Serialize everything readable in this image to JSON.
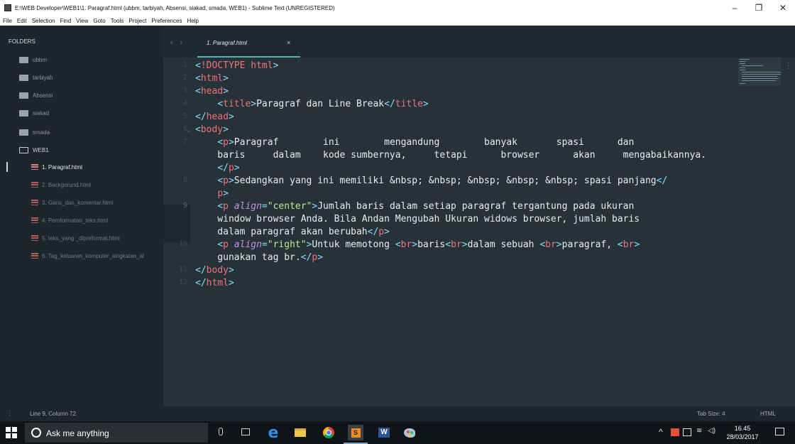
{
  "window": {
    "title": "E:\\WEB Developer\\WEB1\\1. Paragraf.html (ubbm, tarbiyah, Absensi, siakad, smada, WEB1) - Sublime Text (UNREGISTERED)",
    "minimize": "–",
    "maximize": "❐",
    "close": "✕"
  },
  "menu": [
    "File",
    "Edit",
    "Selection",
    "Find",
    "View",
    "Goto",
    "Tools",
    "Project",
    "Preferences",
    "Help"
  ],
  "sidebar": {
    "header": "FOLDERS",
    "folders": [
      "ubbm",
      "tarbiyah",
      "Absensi",
      "siakad",
      "smada",
      "WEB1"
    ],
    "files": [
      "1. Paragraf.html",
      "2. Backgorund.html",
      "3. Garis_dan_komentar.html",
      "4. Pemformatan_teks.html",
      "5. teks_yang _dipreformat.html",
      "6. Tag_keluaran_komputer_singkatan_al"
    ],
    "active_file_index": 0
  },
  "tabs": [
    {
      "label": "1. Paragraf.html",
      "close": "×",
      "active": true
    }
  ],
  "editor": {
    "line_numbers": [
      "1",
      "2",
      "3",
      "4",
      "5",
      "6",
      "7",
      "",
      "",
      "8",
      "",
      "9",
      "",
      "",
      "10",
      "",
      "11",
      "12"
    ],
    "current_line": "9"
  },
  "status": {
    "position": "Line 9, Column 72",
    "tab_size": "Tab Size: 4",
    "syntax": "HTML"
  },
  "taskbar": {
    "search_placeholder": "Ask me anything",
    "time": "16.45",
    "date": "28/03/2017",
    "chevron": "^",
    "ie_glyph": "e",
    "sublime_glyph": "S",
    "word_glyph": "W",
    "wifi_glyph": "≋",
    "volume_glyph": "◁)"
  },
  "colors": {
    "tag": "#f07178",
    "punctuation": "#89ddff",
    "attribute": "#c792ea",
    "string": "#c3e88d",
    "text": "#e8edf0",
    "editor_bg": "#263238",
    "accent": "#4fb5b0"
  }
}
